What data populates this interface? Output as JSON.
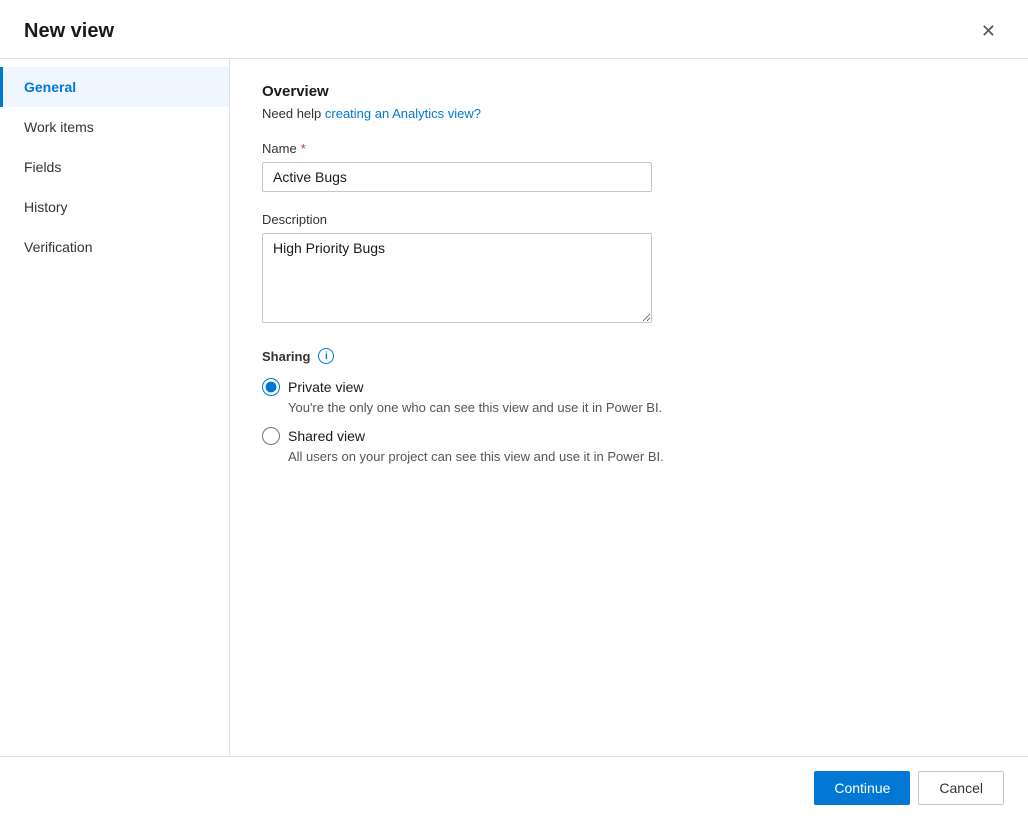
{
  "dialog": {
    "title": "New view",
    "close_label": "✕"
  },
  "sidebar": {
    "items": [
      {
        "id": "general",
        "label": "General",
        "active": true
      },
      {
        "id": "work-items",
        "label": "Work items",
        "active": false
      },
      {
        "id": "fields",
        "label": "Fields",
        "active": false
      },
      {
        "id": "history",
        "label": "History",
        "active": false
      },
      {
        "id": "verification",
        "label": "Verification",
        "active": false
      }
    ]
  },
  "content": {
    "section_title": "Overview",
    "help_text_prefix": "Need help ",
    "help_link_text": "creating an Analytics view?",
    "help_link_url": "#",
    "name_label": "Name",
    "name_required": true,
    "name_value": "Active Bugs",
    "name_placeholder": "",
    "description_label": "Description",
    "description_value": "High Priority Bugs",
    "sharing": {
      "label": "Sharing",
      "info_icon": "i",
      "options": [
        {
          "id": "private",
          "label": "Private view",
          "description": "You're the only one who can see this view and use it in Power BI.",
          "selected": true
        },
        {
          "id": "shared",
          "label": "Shared view",
          "description": "All users on your project can see this view and use it in Power BI.",
          "selected": false
        }
      ]
    }
  },
  "footer": {
    "continue_label": "Continue",
    "cancel_label": "Cancel"
  }
}
